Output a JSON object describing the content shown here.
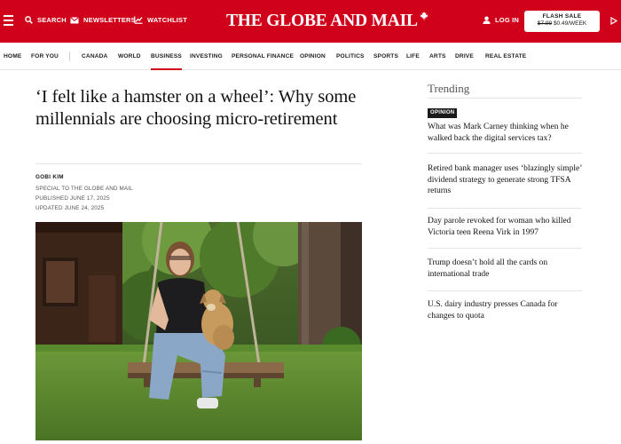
{
  "colors": {
    "brand": "#d0021b",
    "badge": "#1a1a1a"
  },
  "header": {
    "menu_icon": "hamburger-icon",
    "search_label": "SEARCH",
    "newsletters_label": "NEWSLETTERS",
    "watchlist_label": "WATCHLIST",
    "logo_text": "THE GLOBE AND MAIL",
    "login_label": "LOG IN",
    "flash_sale": {
      "title": "FLASH SALE",
      "old_price": "$7.99",
      "new_price": "$0.49/WEEK"
    }
  },
  "nav": {
    "items": [
      "HOME",
      "FOR YOU",
      "CANADA",
      "WORLD",
      "BUSINESS",
      "INVESTING",
      "PERSONAL FINANCE",
      "OPINION",
      "POLITICS",
      "SPORTS",
      "LIFE",
      "ARTS",
      "DRIVE",
      "REAL ESTATE"
    ],
    "active": "BUSINESS"
  },
  "article": {
    "headline": "‘I felt like a hamster on a wheel’: Why some millennials are choosing micro-retirement",
    "author": "GOBI KIM",
    "byline_role": "SPECIAL TO THE GLOBE AND MAIL",
    "published": "PUBLISHED JUNE 17, 2025",
    "updated": "UPDATED JUNE 24, 2025"
  },
  "trending": {
    "title": "Trending",
    "items": [
      {
        "badge": "OPINION",
        "text": "What was Mark Carney thinking when he walked back the digital services tax?"
      },
      {
        "text": "Retired bank manager uses ‘blazingly simple’ dividend strategy to generate strong TFSA returns"
      },
      {
        "text": "Day parole revoked for woman who killed Victoria teen Reena Virk in 1997"
      },
      {
        "text": "Trump doesn’t hold all the cards on international trade"
      },
      {
        "text": "U.S. dairy industry presses Canada for changes to quota"
      }
    ]
  }
}
